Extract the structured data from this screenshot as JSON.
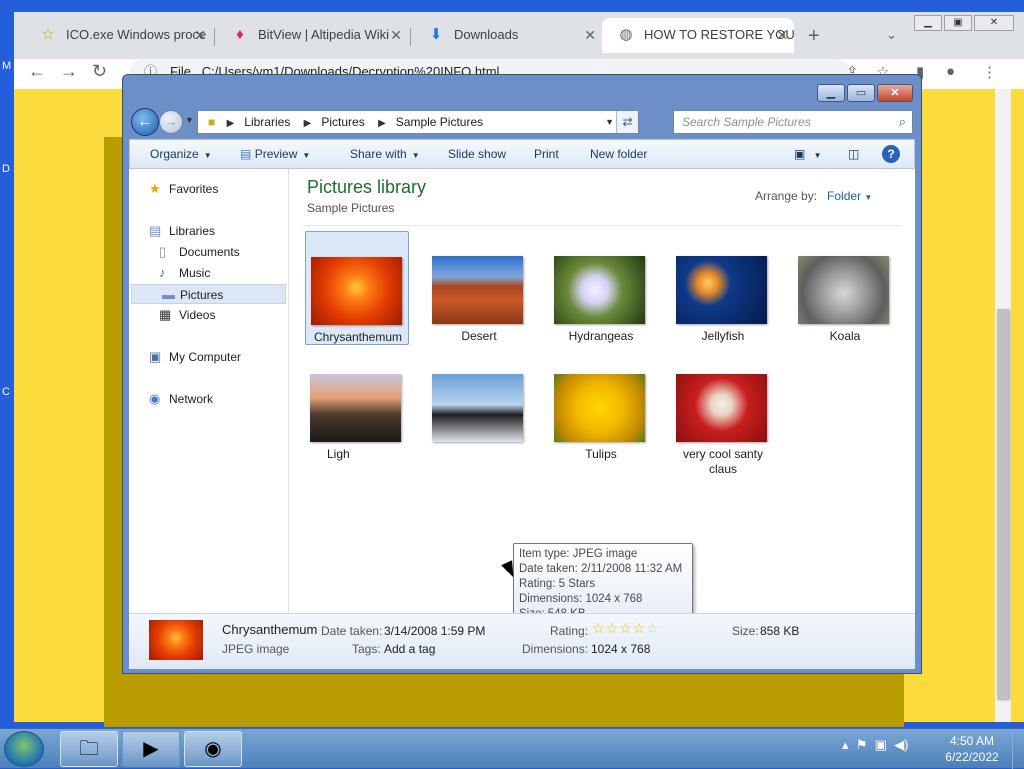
{
  "desktop": {
    "left_letters": [
      "M",
      "D",
      "C"
    ]
  },
  "chrome": {
    "tabs": [
      {
        "title": "ICO.exe Windows proce",
        "icon": "star-icon"
      },
      {
        "title": "BitView | Altipedia Wiki",
        "icon": "flame-icon"
      },
      {
        "title": "Downloads",
        "icon": "download-icon"
      },
      {
        "title": "HOW TO RESTORE YOU",
        "icon": "globe-icon"
      }
    ],
    "omnibox": {
      "scheme_label": "File",
      "url": "C:/Users/vm1/Downloads/Decryption%20INFO.html"
    }
  },
  "explorer": {
    "breadcrumb": [
      "Libraries",
      "Pictures",
      "Sample Pictures"
    ],
    "search_placeholder": "Search Sample Pictures",
    "commands": {
      "organize": "Organize",
      "preview": "Preview",
      "share": "Share with",
      "slideshow": "Slide show",
      "print": "Print",
      "new_folder": "New folder"
    },
    "nav": {
      "favorites": "Favorites",
      "libraries": "Libraries",
      "documents": "Documents",
      "music": "Music",
      "pictures": "Pictures",
      "videos": "Videos",
      "computer": "My Computer",
      "network": "Network"
    },
    "library_title": "Pictures library",
    "library_sub": "Sample Pictures",
    "arrange_label": "Arrange by:",
    "arrange_value": "Folder",
    "items": [
      {
        "name": "Chrysanthemum"
      },
      {
        "name": "Desert"
      },
      {
        "name": "Hydrangeas"
      },
      {
        "name": "Jellyfish"
      },
      {
        "name": "Koala"
      },
      {
        "name": "Ligh"
      },
      {
        "name": ""
      },
      {
        "name": "Tulips"
      },
      {
        "name": "very cool santy claus"
      }
    ],
    "tooltip": {
      "type": "Item type: JPEG image",
      "date": "Date taken: 2/11/2008 11:32 AM",
      "rating": "Rating: 5 Stars",
      "dimensions": "Dimensions: 1024 x 768",
      "size": "Size: 548 KB"
    },
    "details": {
      "name": "Chrysanthemum",
      "type": "JPEG image",
      "date_label": "Date taken:",
      "date_value": "3/14/2008 1:59 PM",
      "tags_label": "Tags:",
      "tags_value": "Add a tag",
      "rating_label": "Rating:",
      "rating_stars": 4,
      "dims_label": "Dimensions:",
      "dims_value": "1024 x 768",
      "size_label": "Size:",
      "size_value": "858 KB"
    }
  },
  "taskbar": {
    "time": "4:50 AM",
    "date": "6/22/2022"
  }
}
